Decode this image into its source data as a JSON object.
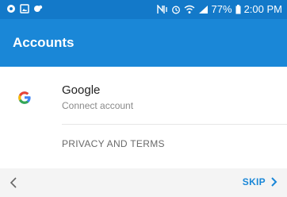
{
  "status_bar": {
    "battery": "77%",
    "time": "2:00 PM",
    "icons": [
      "notification-dot-icon",
      "gallery-icon",
      "app-icon",
      "nfc-icon",
      "alarm-icon",
      "wifi-icon",
      "signal-icon",
      "battery-icon"
    ]
  },
  "app_bar": {
    "title": "Accounts"
  },
  "account": {
    "icon": "google-icon",
    "name": "Google",
    "action": "Connect account"
  },
  "links": {
    "privacy": "PRIVACY AND TERMS"
  },
  "footer": {
    "back_icon": "chevron-left-icon",
    "skip_label": "SKIP",
    "skip_icon": "chevron-right-icon"
  },
  "colors": {
    "status_bar": "#1379c9",
    "app_bar": "#1a87d7",
    "accent": "#1a87d7",
    "footer_bg": "#f4f4f4"
  }
}
